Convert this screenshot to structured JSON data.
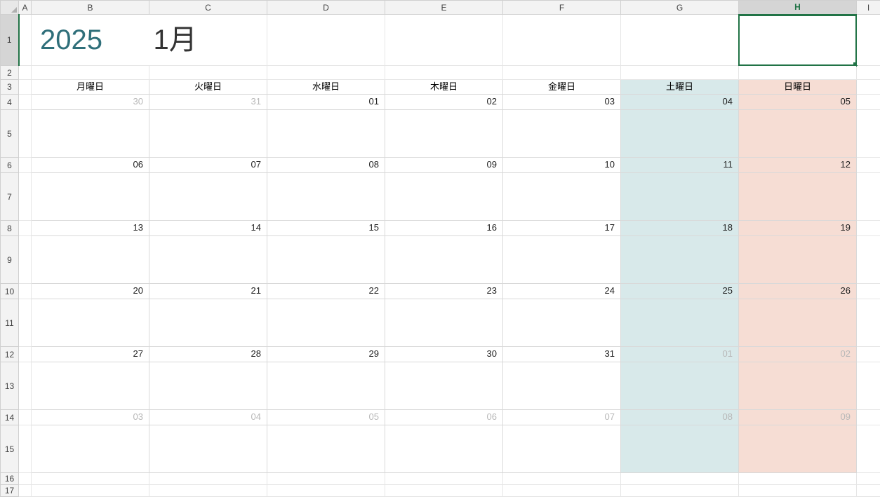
{
  "columns": [
    "A",
    "B",
    "C",
    "D",
    "E",
    "F",
    "G",
    "H",
    "I"
  ],
  "selected_column": "H",
  "selected_row": "1",
  "title": {
    "year": "2025",
    "month": "1月"
  },
  "dow": [
    "月曜日",
    "火曜日",
    "水曜日",
    "木曜日",
    "金曜日",
    "土曜日",
    "日曜日"
  ],
  "weeks": [
    {
      "dates": [
        "30",
        "31",
        "01",
        "02",
        "03",
        "04",
        "05"
      ],
      "dim": [
        true,
        true,
        false,
        false,
        false,
        false,
        false
      ]
    },
    {
      "dates": [
        "06",
        "07",
        "08",
        "09",
        "10",
        "11",
        "12"
      ],
      "dim": [
        false,
        false,
        false,
        false,
        false,
        false,
        false
      ]
    },
    {
      "dates": [
        "13",
        "14",
        "15",
        "16",
        "17",
        "18",
        "19"
      ],
      "dim": [
        false,
        false,
        false,
        false,
        false,
        false,
        false
      ]
    },
    {
      "dates": [
        "20",
        "21",
        "22",
        "23",
        "24",
        "25",
        "26"
      ],
      "dim": [
        false,
        false,
        false,
        false,
        false,
        false,
        false
      ]
    },
    {
      "dates": [
        "27",
        "28",
        "29",
        "30",
        "31",
        "01",
        "02"
      ],
      "dim": [
        false,
        false,
        false,
        false,
        false,
        true,
        true
      ]
    },
    {
      "dates": [
        "03",
        "04",
        "05",
        "06",
        "07",
        "08",
        "09"
      ],
      "dim": [
        true,
        true,
        true,
        true,
        true,
        true,
        true
      ]
    }
  ],
  "row_labels_datebody": [
    [
      "4",
      "5"
    ],
    [
      "6",
      "7"
    ],
    [
      "8",
      "9"
    ],
    [
      "10",
      "11"
    ],
    [
      "12",
      "13"
    ],
    [
      "14",
      "15"
    ]
  ],
  "tail_rows": [
    "16",
    "17"
  ],
  "chart_data": {
    "type": "table",
    "title": "2025 1月 Calendar (Monday start)",
    "columns": [
      "月曜日",
      "火曜日",
      "水曜日",
      "木曜日",
      "金曜日",
      "土曜日",
      "日曜日"
    ],
    "rows": [
      [
        "30",
        "31",
        "01",
        "02",
        "03",
        "04",
        "05"
      ],
      [
        "06",
        "07",
        "08",
        "09",
        "10",
        "11",
        "12"
      ],
      [
        "13",
        "14",
        "15",
        "16",
        "17",
        "18",
        "19"
      ],
      [
        "20",
        "21",
        "22",
        "23",
        "24",
        "25",
        "26"
      ],
      [
        "27",
        "28",
        "29",
        "30",
        "31",
        "01",
        "02"
      ],
      [
        "03",
        "04",
        "05",
        "06",
        "07",
        "08",
        "09"
      ]
    ],
    "out_of_month_mask": [
      [
        true,
        true,
        false,
        false,
        false,
        false,
        false
      ],
      [
        false,
        false,
        false,
        false,
        false,
        false,
        false
      ],
      [
        false,
        false,
        false,
        false,
        false,
        false,
        false
      ],
      [
        false,
        false,
        false,
        false,
        false,
        false,
        false
      ],
      [
        false,
        false,
        false,
        false,
        false,
        true,
        true
      ],
      [
        true,
        true,
        true,
        true,
        true,
        true,
        true
      ]
    ]
  }
}
